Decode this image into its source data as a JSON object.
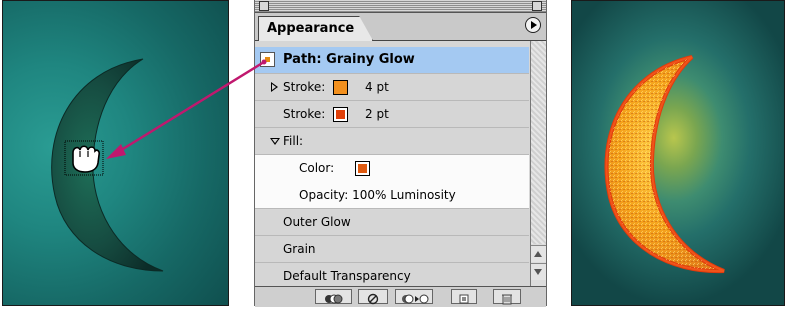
{
  "panel": {
    "tab_label": "Appearance",
    "rows": {
      "path": "Path: Grainy Glow",
      "stroke1_label": "Stroke:",
      "stroke1_value": "4 pt",
      "stroke2_label": "Stroke:",
      "stroke2_value": "2 pt",
      "fill_label": "Fill:",
      "color_label": "Color:",
      "opacity": "Opacity: 100% Luminosity",
      "outer_glow": "Outer Glow",
      "grain": "Grain",
      "default_transparency": "Default Transparency"
    },
    "swatches": {
      "stroke1": "#f2901e",
      "stroke2": "#e0400a",
      "fill": "#e05a10"
    },
    "icons": {
      "menu": "flyout-menu-icon",
      "new_art": "new-art-basic-appearance-icon",
      "clear": "clear-appearance-icon",
      "reduce": "reduce-to-basic-appearance-icon",
      "duplicate": "duplicate-item-icon",
      "delete": "delete-item-icon",
      "cursor": "grabbing-hand-icon"
    }
  },
  "colors": {
    "selection": "#a4c9f2",
    "arrow": "#c0186e",
    "moon_dark": "#0f3d33",
    "moon_glow": "#f3a21a"
  }
}
